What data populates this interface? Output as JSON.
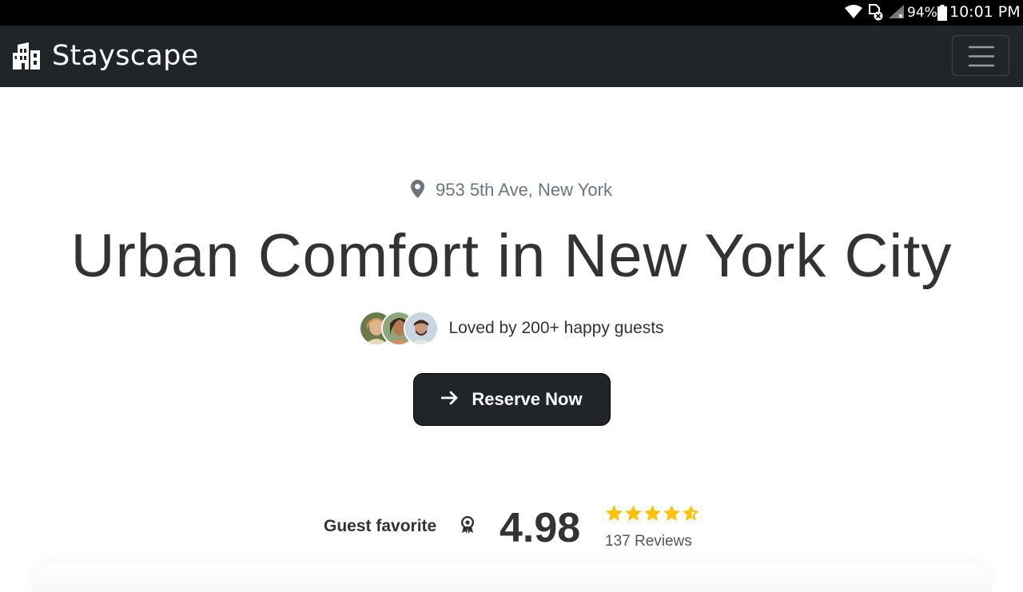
{
  "status_bar": {
    "battery": "94%",
    "time": "10:01 PM",
    "icons": [
      "wifi-icon",
      "document-blocked-icon",
      "signal-icon",
      "battery-icon"
    ]
  },
  "navbar": {
    "brand_name": "Stayscape",
    "brand_icon": "building-icon",
    "menu_icon": "hamburger-icon"
  },
  "hero": {
    "address": "953 5th Ave, New York",
    "title": "Urban Comfort in New York City",
    "guests_text": "Loved by 200+ happy guests",
    "reserve_label": "Reserve Now"
  },
  "rating": {
    "badge_label": "Guest favorite",
    "score": "4.98",
    "stars": 4.5,
    "reviews": "137 Reviews",
    "star_color": "#ffc107"
  },
  "colors": {
    "navbar": "#212529",
    "button": "#212529",
    "muted_text": "#6c757d"
  }
}
